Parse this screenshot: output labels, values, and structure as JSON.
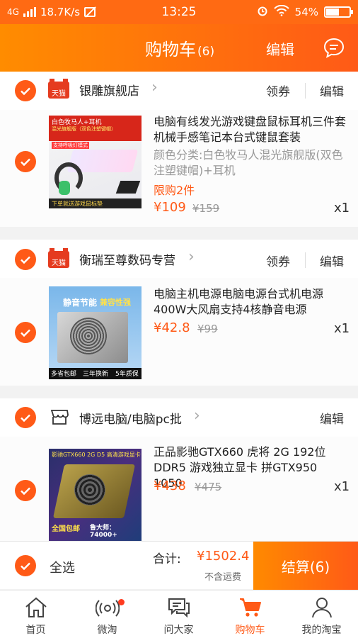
{
  "status_bar": {
    "network": "4G",
    "speed": "18.7K/s",
    "time": "13:25",
    "battery": "54%",
    "battery_level": 0.54
  },
  "header": {
    "title": "购物车",
    "count": "(6)",
    "edit": "编辑",
    "message_icon": "message-bubble-icon"
  },
  "stores": [
    {
      "name": "银雕旗舰店",
      "badge": "天猫",
      "coupon": "领券",
      "edit": "编辑",
      "items": [
        {
          "title": "电脑有线发光游戏键盘鼠标耳机三件套机械手感笔记本台式键鼠套装",
          "spec": "颜色分类:白色牧马人混光旗舰版(双色注塑键帽)+耳机",
          "limit": "限购2件",
          "price": "109",
          "old_price": "159",
          "qty": "x1",
          "thumb_text": [
            "白色牧马人+耳机",
            "混光旗舰版（双色注塑键帽）",
            "支持呼吸灯模式",
            "下单就送游戏鼠标垫"
          ]
        }
      ]
    },
    {
      "name": "衡瑞至尊数码专营",
      "badge": "天猫",
      "coupon": "领券",
      "edit": "编辑",
      "items": [
        {
          "title": "电脑主机电源电脑电源台式机电源400W大风扇支持4核静音电源",
          "price": "42.8",
          "old_price": "99",
          "qty": "x1",
          "thumb_text": [
            "静音节能",
            "兼容性强",
            "多省包邮",
            "三年换新",
            "5年质保"
          ]
        }
      ]
    },
    {
      "name": "博远电脑/电脑pc批",
      "edit": "编辑",
      "items": [
        {
          "title": "正品影驰GTX660 虎将 2G 192位DDR5 游戏独立显卡 拼GTX950 1050",
          "price": "438",
          "old_price": "475",
          "qty": "x1",
          "thumb_text": [
            "影驰GTX660 2G D5 高清游戏显卡",
            "全国包邮",
            "鲁大师：74000+"
          ]
        }
      ]
    }
  ],
  "currency": "¥",
  "checkout": {
    "select_all": "全选",
    "total_label": "合计:",
    "total_value": "¥1502.4",
    "shipping_note": "不含运费",
    "pay_button": "结算(6)"
  },
  "tabs": [
    {
      "label": "首页",
      "icon": "home-icon"
    },
    {
      "label": "微淘",
      "icon": "weitao-icon"
    },
    {
      "label": "问大家",
      "icon": "chat-bubbles-icon"
    },
    {
      "label": "购物车",
      "icon": "shopping-cart-icon",
      "active": true
    },
    {
      "label": "我的淘宝",
      "icon": "user-icon"
    }
  ],
  "colors": {
    "accent": "#ff5a17",
    "header_start": "#ff8c00",
    "tmall_red": "#e53b1f"
  }
}
